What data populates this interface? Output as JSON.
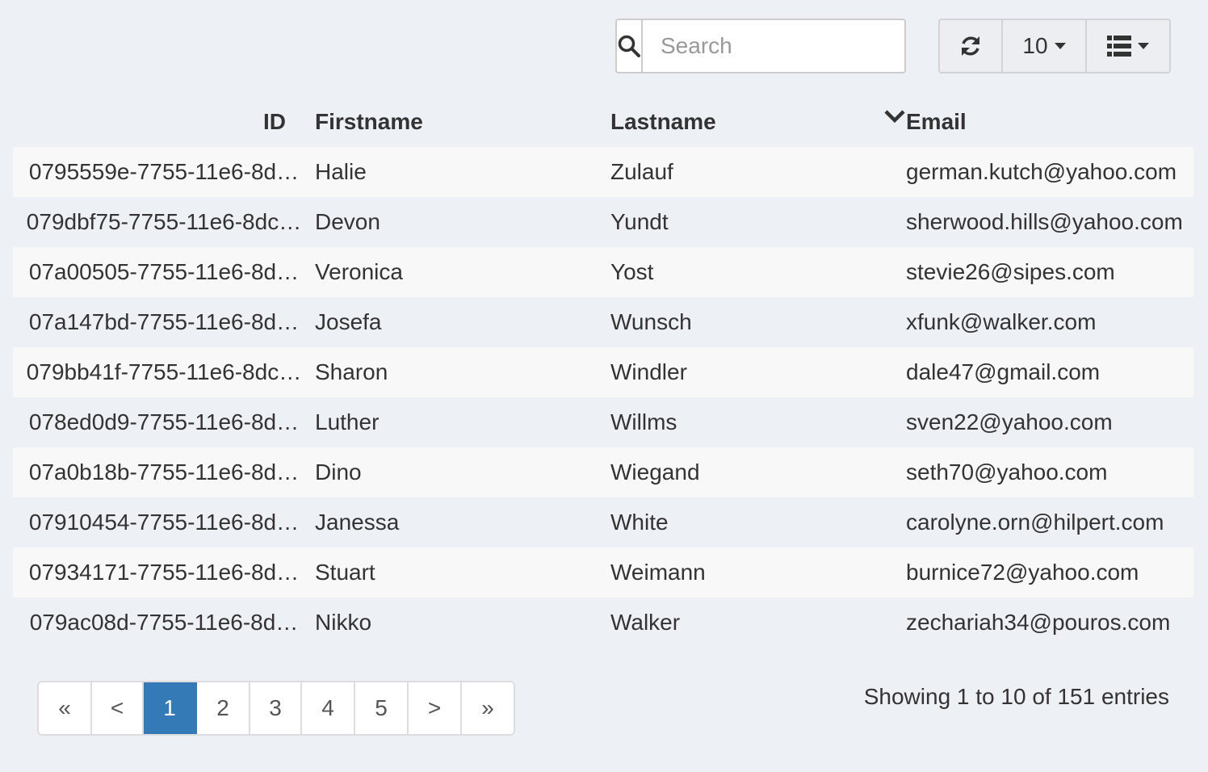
{
  "toolbar": {
    "search_placeholder": "Search",
    "page_size": "10"
  },
  "table": {
    "headers": [
      "ID",
      "Firstname",
      "Lastname",
      "Email"
    ],
    "rows": [
      [
        "0795559e-7755-11e6-8d…",
        "Halie",
        "Zulauf",
        "german.kutch@yahoo.com"
      ],
      [
        "079dbf75-7755-11e6-8dc…",
        "Devon",
        "Yundt",
        "sherwood.hills@yahoo.com"
      ],
      [
        "07a00505-7755-11e6-8d…",
        "Veronica",
        "Yost",
        "stevie26@sipes.com"
      ],
      [
        "07a147bd-7755-11e6-8d…",
        "Josefa",
        "Wunsch",
        "xfunk@walker.com"
      ],
      [
        "079bb41f-7755-11e6-8dc…",
        "Sharon",
        "Windler",
        "dale47@gmail.com"
      ],
      [
        "078ed0d9-7755-11e6-8d…",
        "Luther",
        "Willms",
        "sven22@yahoo.com"
      ],
      [
        "07a0b18b-7755-11e6-8d…",
        "Dino",
        "Wiegand",
        "seth70@yahoo.com"
      ],
      [
        "07910454-7755-11e6-8d…",
        "Janessa",
        "White",
        "carolyne.orn@hilpert.com"
      ],
      [
        "07934171-7755-11e6-8d…",
        "Stuart",
        "Weimann",
        "burnice72@yahoo.com"
      ],
      [
        "079ac08d-7755-11e6-8d…",
        "Nikko",
        "Walker",
        "zechariah34@pouros.com"
      ]
    ]
  },
  "pagination": {
    "items": [
      "«",
      "<",
      "1",
      "2",
      "3",
      "4",
      "5",
      ">",
      "»"
    ],
    "active": "1"
  },
  "status": {
    "info": "Showing 1 to 10 of 151 entries"
  },
  "icons": {
    "search": "search-icon",
    "refresh": "refresh-icon",
    "columns": "list-icon",
    "sort": "chevron-down-icon"
  },
  "colors": {
    "accent": "#337ab7",
    "background": "#edf0f4"
  }
}
